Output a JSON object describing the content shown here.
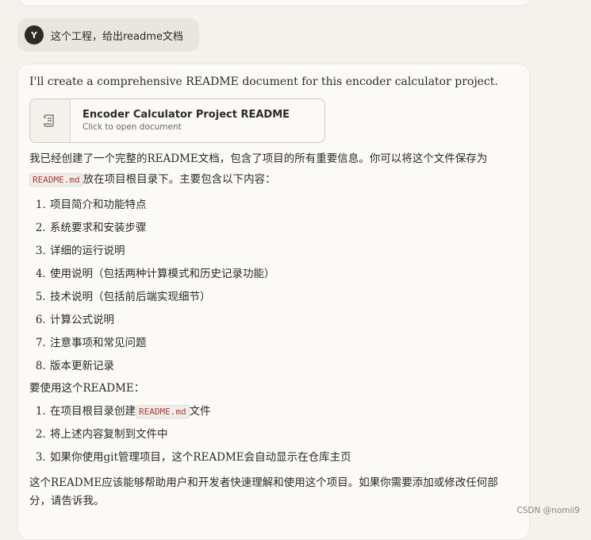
{
  "user_message": {
    "avatar_initial": "Y",
    "text": "这个工程，给出readme文档"
  },
  "reply": {
    "intro": "I'll create a comprehensive README document for this encoder calculator project.",
    "artifact": {
      "icon": "document-icon",
      "title": "Encoder Calculator Project README",
      "subtitle": "Click to open document"
    },
    "para1_part1": "我已经创建了一个完整的README文档，包含了项目的所有重要信息。你可以将这个文件保存为",
    "para1_code": "README.md",
    "para1_part2": "放在项目根目录下。主要包含以下内容：",
    "contents": [
      "项目简介和功能特点",
      "系统要求和安装步骤",
      "详细的运行说明",
      "使用说明（包括两种计算模式和历史记录功能）",
      "技术说明（包括前后端实现细节）",
      "计算公式说明",
      "注意事项和常见问题",
      "版本更新记录"
    ],
    "usage_heading": "要使用这个README：",
    "step1_part1": "在项目根目录创建",
    "step1_code": "README.md",
    "step1_part2": "文件",
    "step2": "将上述内容复制到文件中",
    "step3": "如果你使用git管理项目，这个README会自动显示在仓库主页",
    "closing": "这个README应该能够帮助用户和开发者快速理解和使用这个项目。如果你需要添加或修改任何部分，请告诉我。"
  },
  "watermark": "CSDN @nomil9"
}
